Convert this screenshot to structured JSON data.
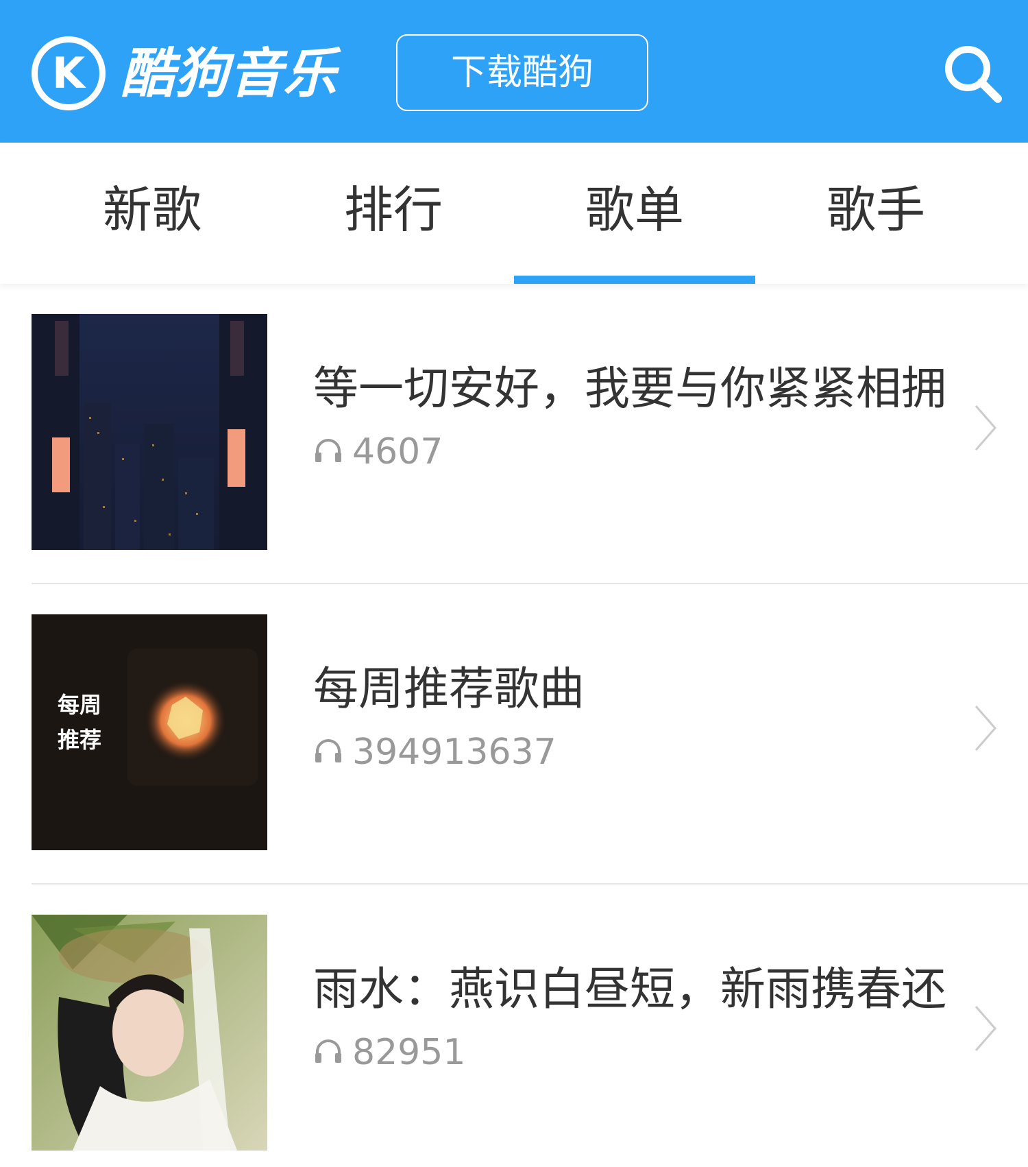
{
  "header": {
    "logo_letter": "K",
    "logo_text": "酷狗音乐",
    "download_label": "下载酷狗",
    "search_icon": "search-icon",
    "colors": {
      "brand": "#2ea2f7",
      "text": "#ffffff"
    }
  },
  "tabs": [
    {
      "label": "新歌",
      "active": false
    },
    {
      "label": "排行",
      "active": false
    },
    {
      "label": "歌单",
      "active": true
    },
    {
      "label": "歌手",
      "active": false
    }
  ],
  "playlists": [
    {
      "title": "等一切安好，我要与你紧紧相拥",
      "plays": "4607",
      "cover": "night-city-illustration"
    },
    {
      "title": "每周推荐歌曲",
      "plays": "394913637",
      "cover": "weekly-recommend-cover",
      "cover_text": "每周\n推荐"
    },
    {
      "title": "雨水：燕识白昼短，新雨携春还",
      "plays": "82951",
      "cover": "woman-portrait-photo"
    }
  ],
  "colors": {
    "accent": "#2ea2f7",
    "title_text": "#333333",
    "meta_text": "#999999",
    "divider": "#e5e5e5"
  }
}
